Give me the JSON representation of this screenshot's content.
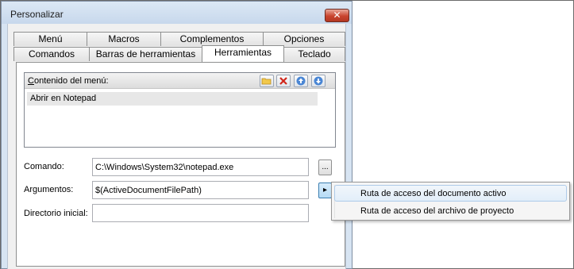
{
  "window": {
    "title": "Personalizar",
    "close_label": "✕"
  },
  "tabs": {
    "row_back": [
      "Menú",
      "Macros",
      "Complementos",
      "Opciones"
    ],
    "row_front": [
      "Comandos",
      "Barras de herramientas",
      "Herramientas",
      "Teclado"
    ],
    "active": "Herramientas"
  },
  "menu_contents": {
    "label_prefix": "C",
    "label_rest": "ontenido del menú:",
    "toolbar_icons": [
      "folder-icon",
      "delete-icon",
      "move-up-icon",
      "move-down-icon"
    ],
    "items": [
      "Abrir en Notepad"
    ]
  },
  "fields": {
    "command_label": "Comando:",
    "command_value": "C:\\Windows\\System32\\notepad.exe",
    "browse_label": "...",
    "arguments_label": "Argumentos:",
    "arguments_value": "$(ActiveDocumentFilePath)",
    "arguments_menu_label": "▸",
    "initial_dir_label": "Directorio inicial:",
    "initial_dir_value": ""
  },
  "popup_menu": {
    "items": [
      "Ruta de acceso del documento activo",
      "Ruta de acceso del archivo de proyecto"
    ],
    "highlighted_index": 0
  },
  "colors": {
    "title_bar": "#c7d8ec",
    "close_button": "#c9452f",
    "selected_row": "#e7e7e7",
    "menu_hover": "#e2eef9"
  }
}
